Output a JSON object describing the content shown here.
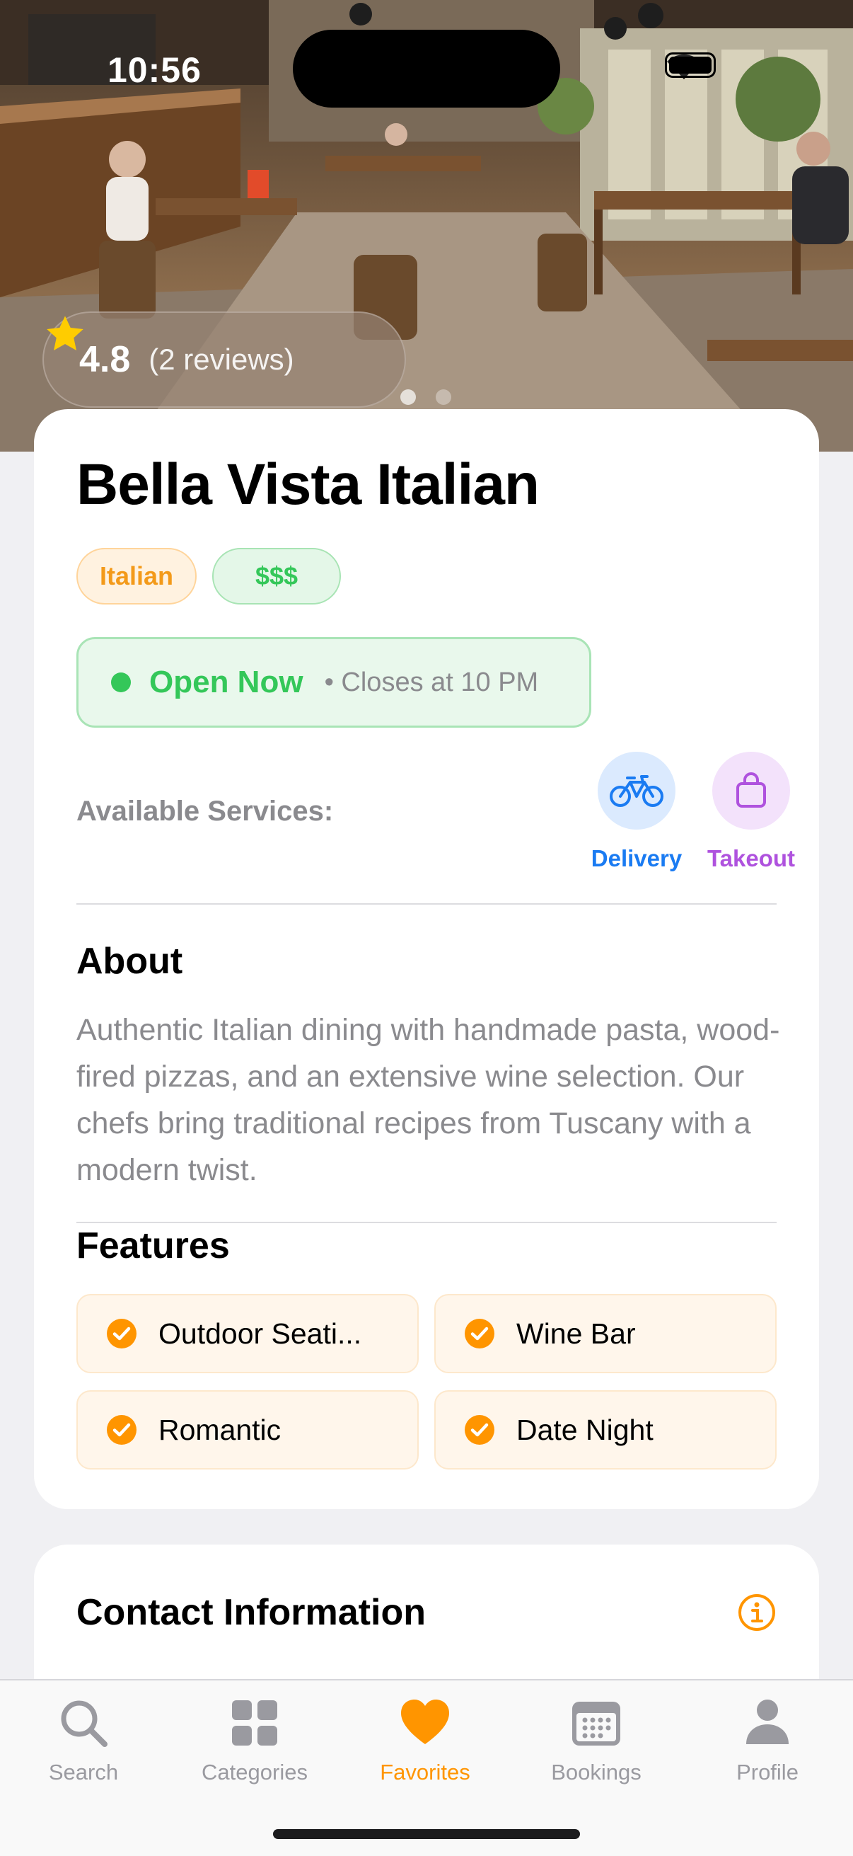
{
  "status_bar": {
    "time": "10:56"
  },
  "hero": {
    "rating": "4.8",
    "reviews": "(2 reviews)",
    "page_count": 2,
    "active_page": 1
  },
  "restaurant": {
    "name": "Bella Vista Italian",
    "cuisine_tag": "Italian",
    "price_tag": "$$$",
    "open_status": "Open Now",
    "closes_text": "• Closes at 10 PM",
    "services_label": "Available Services:",
    "services": [
      {
        "label": "Delivery",
        "icon": "bicycle-icon",
        "color": "#1a7bf2"
      },
      {
        "label": "Takeout",
        "icon": "shopping-bag-icon",
        "color": "#af52de"
      }
    ],
    "about_title": "About",
    "about_text": "Authentic Italian dining with handmade pasta, wood-fired pizzas, and an extensive wine selection. Our chefs bring traditional recipes from Tuscany with a modern twist.",
    "features_title": "Features",
    "features": [
      "Outdoor Seati...",
      "Wine Bar",
      "Romantic",
      "Date Night"
    ]
  },
  "contact": {
    "title": "Contact Information",
    "icon": "info-icon"
  },
  "tabbar": {
    "tabs": [
      {
        "label": "Search",
        "icon": "search-icon"
      },
      {
        "label": "Categories",
        "icon": "grid-icon"
      },
      {
        "label": "Favorites",
        "icon": "heart-icon"
      },
      {
        "label": "Bookings",
        "icon": "calendar-icon"
      },
      {
        "label": "Profile",
        "icon": "person-icon"
      }
    ],
    "active": "Favorites"
  },
  "colors": {
    "accent": "#ff9500",
    "open_green": "#34c759",
    "delivery_blue": "#1a7bf2",
    "takeout_purple": "#af52de",
    "star": "#ffcc00"
  }
}
